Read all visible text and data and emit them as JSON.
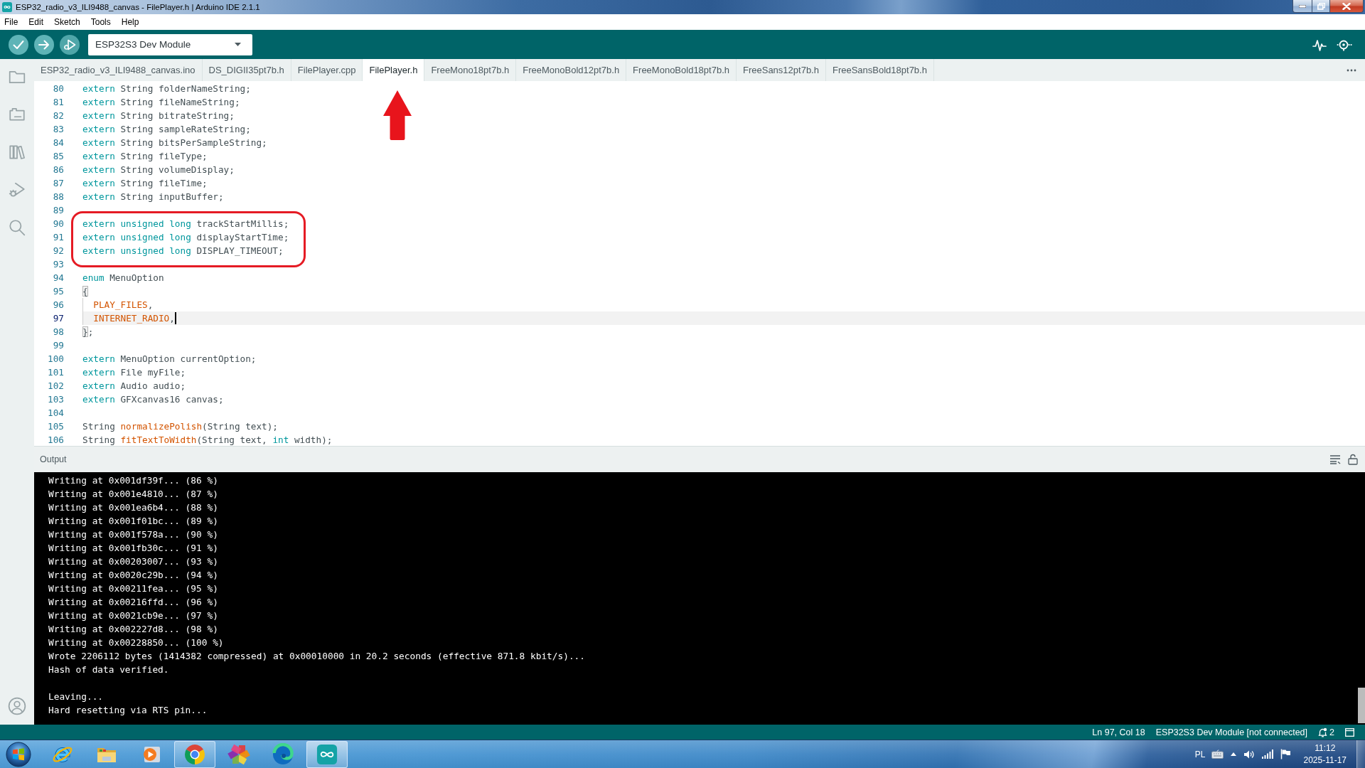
{
  "window": {
    "title": "ESP32_radio_v3_ILI9488_canvas - FilePlayer.h | Arduino IDE 2.1.1"
  },
  "menu": [
    "File",
    "Edit",
    "Sketch",
    "Tools",
    "Help"
  ],
  "toolbar": {
    "board": "ESP32S3 Dev Module"
  },
  "tabs": [
    {
      "label": "ESP32_radio_v3_ILI9488_canvas.ino",
      "selected": false
    },
    {
      "label": "DS_DIGII35pt7b.h",
      "selected": false
    },
    {
      "label": "FilePlayer.cpp",
      "selected": false
    },
    {
      "label": "FilePlayer.h",
      "selected": true
    },
    {
      "label": "FreeMono18pt7b.h",
      "selected": false
    },
    {
      "label": "FreeMonoBold12pt7b.h",
      "selected": false
    },
    {
      "label": "FreeMonoBold18pt7b.h",
      "selected": false
    },
    {
      "label": "FreeSans12pt7b.h",
      "selected": false
    },
    {
      "label": "FreeSansBold18pt7b.h",
      "selected": false
    }
  ],
  "editor": {
    "lines": [
      {
        "number": "80",
        "current": false,
        "indented": false,
        "tokens": [
          {
            "kind": "keyword",
            "text": "extern"
          },
          {
            "kind": "plain",
            "text": " String folderNameString;"
          }
        ]
      },
      {
        "number": "81",
        "current": false,
        "indented": false,
        "tokens": [
          {
            "kind": "keyword",
            "text": "extern"
          },
          {
            "kind": "plain",
            "text": " String fileNameString;"
          }
        ]
      },
      {
        "number": "82",
        "current": false,
        "indented": false,
        "tokens": [
          {
            "kind": "keyword",
            "text": "extern"
          },
          {
            "kind": "plain",
            "text": " String bitrateString;"
          }
        ]
      },
      {
        "number": "83",
        "current": false,
        "indented": false,
        "tokens": [
          {
            "kind": "keyword",
            "text": "extern"
          },
          {
            "kind": "plain",
            "text": " String sampleRateString;"
          }
        ]
      },
      {
        "number": "84",
        "current": false,
        "indented": false,
        "tokens": [
          {
            "kind": "keyword",
            "text": "extern"
          },
          {
            "kind": "plain",
            "text": " String bitsPerSampleString;"
          }
        ]
      },
      {
        "number": "85",
        "current": false,
        "indented": false,
        "tokens": [
          {
            "kind": "keyword",
            "text": "extern"
          },
          {
            "kind": "plain",
            "text": " String fileType;"
          }
        ]
      },
      {
        "number": "86",
        "current": false,
        "indented": false,
        "tokens": [
          {
            "kind": "keyword",
            "text": "extern"
          },
          {
            "kind": "plain",
            "text": " String volumeDisplay;"
          }
        ]
      },
      {
        "number": "87",
        "current": false,
        "indented": false,
        "tokens": [
          {
            "kind": "keyword",
            "text": "extern"
          },
          {
            "kind": "plain",
            "text": " String fileTime;"
          }
        ]
      },
      {
        "number": "88",
        "current": false,
        "indented": false,
        "tokens": [
          {
            "kind": "keyword",
            "text": "extern"
          },
          {
            "kind": "plain",
            "text": " String inputBuffer;"
          }
        ]
      },
      {
        "number": "89",
        "current": false,
        "indented": false
      },
      {
        "number": "90",
        "current": false,
        "indented": false,
        "tokens": [
          {
            "kind": "keyword",
            "text": "extern unsigned long"
          },
          {
            "kind": "plain",
            "text": " trackStartMillis;"
          }
        ]
      },
      {
        "number": "91",
        "current": false,
        "indented": false,
        "tokens": [
          {
            "kind": "keyword",
            "text": "extern unsigned long"
          },
          {
            "kind": "plain",
            "text": " displayStartTime;"
          }
        ]
      },
      {
        "number": "92",
        "current": false,
        "indented": false,
        "tokens": [
          {
            "kind": "keyword",
            "text": "extern unsigned long"
          },
          {
            "kind": "plain",
            "text": " DISPLAY_TIMEOUT;"
          }
        ]
      },
      {
        "number": "93",
        "current": false,
        "indented": false
      },
      {
        "number": "94",
        "current": false,
        "indented": false,
        "tokens": [
          {
            "kind": "keyword",
            "text": "enum"
          },
          {
            "kind": "plain",
            "text": " MenuOption"
          }
        ]
      },
      {
        "number": "95",
        "current": false,
        "indented": false,
        "tokens": [
          {
            "kind": "bracket",
            "text": "{"
          }
        ]
      },
      {
        "number": "96",
        "current": false,
        "indented": true,
        "tokens": [
          {
            "kind": "constant",
            "text": "PLAY_FILES"
          },
          {
            "kind": "plain",
            "text": ","
          }
        ]
      },
      {
        "number": "97",
        "current": true,
        "indented": true,
        "tokens": [
          {
            "kind": "constant",
            "text": "INTERNET_RADIO"
          },
          {
            "kind": "plain",
            "text": ","
          }
        ]
      },
      {
        "number": "98",
        "current": false,
        "indented": false,
        "tokens": [
          {
            "kind": "bracket",
            "text": "}"
          },
          {
            "kind": "plain",
            "text": ";"
          }
        ]
      },
      {
        "number": "99",
        "current": false,
        "indented": false
      },
      {
        "number": "100",
        "current": false,
        "indented": false,
        "tokens": [
          {
            "kind": "keyword",
            "text": "extern"
          },
          {
            "kind": "plain",
            "text": " MenuOption currentOption;"
          }
        ]
      },
      {
        "number": "101",
        "current": false,
        "indented": false,
        "tokens": [
          {
            "kind": "keyword",
            "text": "extern"
          },
          {
            "kind": "plain",
            "text": " File myFile;"
          }
        ]
      },
      {
        "number": "102",
        "current": false,
        "indented": false,
        "tokens": [
          {
            "kind": "keyword",
            "text": "extern"
          },
          {
            "kind": "plain",
            "text": " Audio audio;"
          }
        ]
      },
      {
        "number": "103",
        "current": false,
        "indented": false,
        "tokens": [
          {
            "kind": "keyword",
            "text": "extern"
          },
          {
            "kind": "plain",
            "text": " GFXcanvas16 canvas;"
          }
        ]
      },
      {
        "number": "104",
        "current": false,
        "indented": false
      },
      {
        "number": "105",
        "current": false,
        "indented": false,
        "tokens": [
          {
            "kind": "plain",
            "text": "String "
          },
          {
            "kind": "function",
            "text": "normalizePolish"
          },
          {
            "kind": "plain",
            "text": "(String text);"
          }
        ]
      },
      {
        "number": "106",
        "current": false,
        "indented": false,
        "tokens": [
          {
            "kind": "plain",
            "text": "String "
          },
          {
            "kind": "function",
            "text": "fitTextToWidth"
          },
          {
            "kind": "plain",
            "text": "(String text, "
          },
          {
            "kind": "keyword",
            "text": "int"
          },
          {
            "kind": "plain",
            "text": " width);"
          }
        ]
      }
    ]
  },
  "output": {
    "title": "Output",
    "blocks": [
      [
        "Writing at 0x001df39f... (86 %)",
        "Writing at 0x001e4810... (87 %)",
        "Writing at 0x001ea6b4... (88 %)",
        "Writing at 0x001f01bc... (89 %)",
        "Writing at 0x001f578a... (90 %)",
        "Writing at 0x001fb30c... (91 %)",
        "Writing at 0x00203007... (93 %)",
        "Writing at 0x0020c29b... (94 %)",
        "Writing at 0x00211fea... (95 %)",
        "Writing at 0x00216ffd... (96 %)",
        "Writing at 0x0021cb9e... (97 %)",
        "Writing at 0x002227d8... (98 %)",
        "Writing at 0x00228850... (100 %)",
        "Wrote 2206112 bytes (1414382 compressed) at 0x00010000 in 20.2 seconds (effective 871.8 kbit/s)...",
        "Hash of data verified."
      ],
      [
        "Leaving...",
        "Hard resetting via RTS pin..."
      ]
    ]
  },
  "status_bar": {
    "position": "Ln 97, Col 18",
    "board": "ESP32S3 Dev Module [not connected]",
    "notifications": "2"
  },
  "taskbar": {
    "apps": [
      {
        "kind": "e-browser",
        "running": false,
        "active": false
      },
      {
        "kind": "folder",
        "running": false,
        "active": false
      },
      {
        "kind": "player",
        "running": false,
        "active": false
      },
      {
        "kind": "ring-browser",
        "running": true,
        "active": false
      },
      {
        "kind": "pinwheel",
        "running": false,
        "active": false
      },
      {
        "kind": "swirl-browser",
        "running": false,
        "active": false
      },
      {
        "kind": "infinity",
        "running": true,
        "active": true
      }
    ],
    "tray": {
      "language": "PL",
      "time": "11:12",
      "date": "2025-11-17"
    }
  }
}
